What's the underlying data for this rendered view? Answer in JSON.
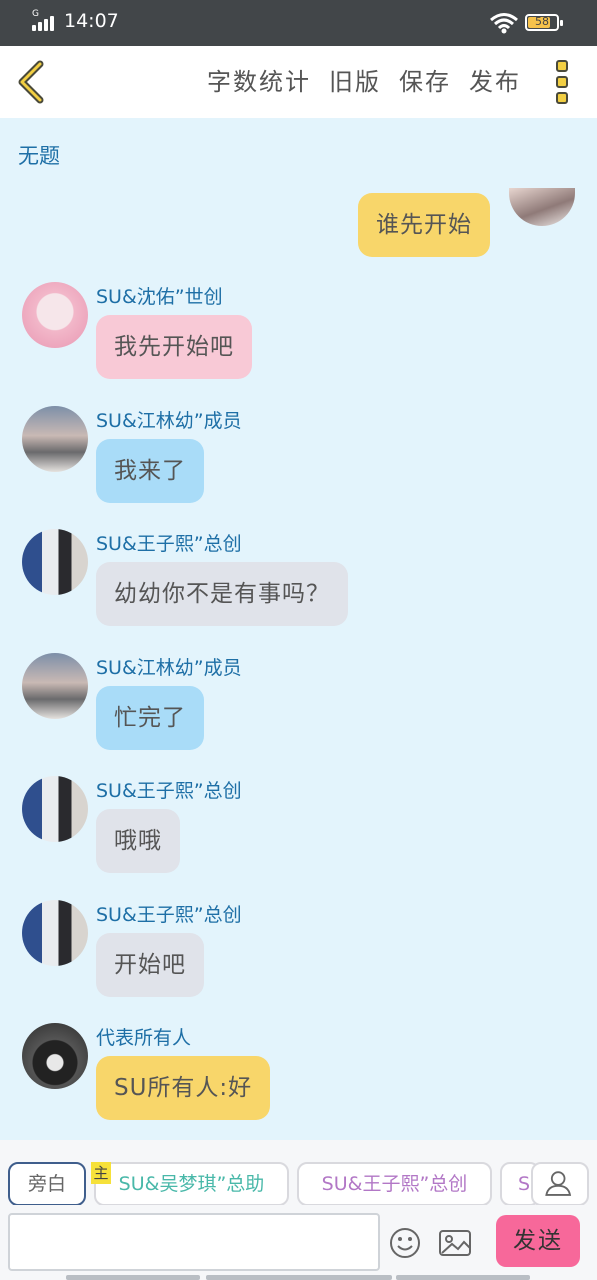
{
  "status_bar": {
    "time": "14:07",
    "battery": "58"
  },
  "header": {
    "actions": [
      "字数统计",
      "旧版",
      "保存",
      "发布"
    ]
  },
  "chat": {
    "title": "无题",
    "my_message": "谁先开始",
    "messages": [
      {
        "name": "SU&沈佑”世创",
        "text": "我先开始吧",
        "style": "pink"
      },
      {
        "name": "SU&江林幼”成员",
        "text": "我来了",
        "style": "blue"
      },
      {
        "name": "SU&王子熙”总创",
        "text": "幼幼你不是有事吗？",
        "style": "gray"
      },
      {
        "name": "SU&江林幼”成员",
        "text": "忙完了",
        "style": "blue"
      },
      {
        "name": "SU&王子熙”总创",
        "text": "哦哦",
        "style": "gray"
      },
      {
        "name": "SU&王子熙”总创",
        "text": "开始吧",
        "style": "gray"
      },
      {
        "name": "代表所有人",
        "text": "SU所有人:好",
        "style": "yellow"
      }
    ]
  },
  "roles": {
    "narrator": "旁白",
    "main_mark": "主",
    "chips": [
      "SU&吴梦琪”总助",
      "SU&王子熙”总创",
      "S"
    ]
  },
  "composer": {
    "input_value": "",
    "send_label": "发送"
  },
  "colors": {
    "accent_send": "#f7689a",
    "chat_bg": "#e3f4fc",
    "link_blue": "#1e6fa6"
  }
}
